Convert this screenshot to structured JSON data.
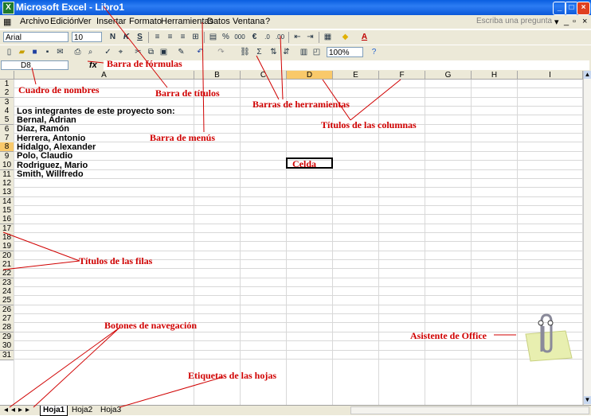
{
  "window": {
    "title": "Microsoft Excel - Libro1"
  },
  "menu": {
    "items": [
      "Archivo",
      "Edición",
      "Ver",
      "Insertar",
      "Formato",
      "Herramientas",
      "Datos",
      "Ventana",
      "?"
    ],
    "help_placeholder": "Escriba una pregunta"
  },
  "toolbar": {
    "font": "Arial",
    "size": "10",
    "zoom": "100%",
    "bold": "N",
    "italic": "K",
    "underline": "S",
    "percent": "%",
    "thousands": "000",
    "euro": "€",
    "sigma": "Σ"
  },
  "formula_bar": {
    "cell_ref": "D8",
    "fx": "fx",
    "content": ""
  },
  "sheet": {
    "columns": [
      "A",
      "B",
      "C",
      "D",
      "E",
      "F",
      "G",
      "H",
      "I"
    ],
    "selected_column": "D",
    "selected_row": "8",
    "rows": [
      "1",
      "2",
      "3",
      "4",
      "5",
      "6",
      "7",
      "8",
      "9",
      "10",
      "11",
      "12",
      "13",
      "14",
      "15",
      "16",
      "17",
      "18",
      "19",
      "20",
      "21",
      "22",
      "23",
      "24",
      "25",
      "26",
      "27",
      "28",
      "29",
      "30",
      "31"
    ],
    "cells": [
      {
        "row": 4,
        "text": "Los integrantes de este proyecto son:"
      },
      {
        "row": 5,
        "text": "Bernal, Adrian"
      },
      {
        "row": 6,
        "text": "Díaz, Ramón"
      },
      {
        "row": 7,
        "text": "Herrera, Antonio"
      },
      {
        "row": 8,
        "text": "Hidalgo, Alexander"
      },
      {
        "row": 9,
        "text": "Polo, Claudio"
      },
      {
        "row": 10,
        "text": "Rodriguez, Mario"
      },
      {
        "row": 11,
        "text": "Smith, Willfredo"
      }
    ]
  },
  "tabs": [
    "Hoja1",
    "Hoja2",
    "Hoja3"
  ],
  "annotations": {
    "formula_bar": "Barra de fórmulas",
    "name_box": "Cuadro de nombres",
    "title_bar": "Barra de títulos",
    "toolbars": "Barras de herramientas",
    "column_titles": "Títulos de las columnas",
    "menu_bar": "Barra de menús",
    "cell": "Celda",
    "row_titles": "Títulos de las filas",
    "nav_buttons": "Botones de navegación",
    "office_assistant": "Asistente de Office",
    "sheet_tabs": "Etiquetas de las hojas"
  },
  "colors": {
    "annotation": "#d00000",
    "selected_header": "#f9c96a",
    "titlebar": "#0a5ee0"
  }
}
